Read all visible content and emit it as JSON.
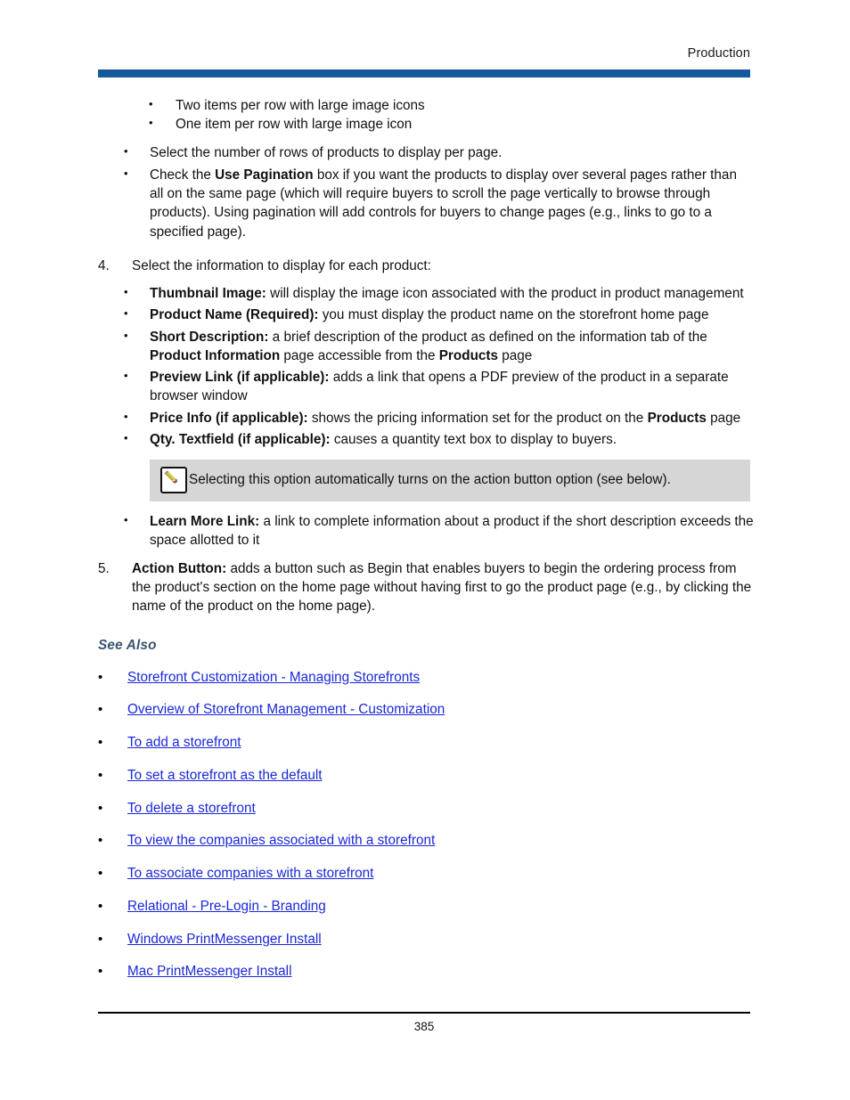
{
  "header": {
    "title": "Production",
    "rule_color": "#14579b"
  },
  "content": {
    "sub_bullets_top": [
      "Two items per row with large image icons",
      "One item per row with large image icon"
    ],
    "level2_bullets": [
      {
        "segments": [
          {
            "text": "Select the number of rows of products to display per page.",
            "bold": false
          }
        ]
      },
      {
        "segments": [
          {
            "text": "Check the ",
            "bold": false
          },
          {
            "text": "Use Pagination",
            "bold": true
          },
          {
            "text": " box if you want the products to display over several pages rather than all on the same page (which will require buyers to scroll the page vertically to browse through products). Using pagination will add controls for buyers to change pages (e.g., links to go to a specified page).",
            "bold": false
          }
        ]
      }
    ],
    "item4": {
      "number": "4.",
      "text": "Select the information to display for each product:"
    },
    "item4_bullets": [
      {
        "segments": [
          {
            "text": "Thumbnail Image:",
            "bold": true
          },
          {
            "text": " will display the image icon associated with the product in product management",
            "bold": false
          }
        ]
      },
      {
        "segments": [
          {
            "text": "Product Name (Required):",
            "bold": true
          },
          {
            "text": " you must display the product name on the storefront home page",
            "bold": false
          }
        ]
      },
      {
        "segments": [
          {
            "text": "Short Description:",
            "bold": true
          },
          {
            "text": " a brief description of the product as defined on the information tab of the ",
            "bold": false
          },
          {
            "text": "Product Information",
            "bold": true
          },
          {
            "text": " page accessible from the ",
            "bold": false
          },
          {
            "text": "Products",
            "bold": true
          },
          {
            "text": " page",
            "bold": false
          }
        ]
      },
      {
        "segments": [
          {
            "text": "Preview Link (if applicable):",
            "bold": true
          },
          {
            "text": " adds a link that opens a PDF preview of the product in a separate browser window",
            "bold": false
          }
        ]
      },
      {
        "segments": [
          {
            "text": "Price Info (if applicable):",
            "bold": true
          },
          {
            "text": " shows the pricing information set for the product on the ",
            "bold": false
          },
          {
            "text": "Products",
            "bold": true
          },
          {
            "text": " page",
            "bold": false
          }
        ]
      },
      {
        "segments": [
          {
            "text": "Qty. Textfield (if applicable):",
            "bold": true
          },
          {
            "text": " causes a quantity text box to display to buyers.",
            "bold": false
          }
        ]
      }
    ],
    "note": {
      "icon": "pencil-note-icon",
      "text": "Selecting this option automatically turns on the action button option (see below).",
      "background": "#d6d6d6"
    },
    "item4_bullets_after_note": [
      {
        "segments": [
          {
            "text": "Learn More Link:",
            "bold": true
          },
          {
            "text": " a link to complete information about a product if the short description exceeds the space allotted to it",
            "bold": false
          }
        ]
      }
    ],
    "item5": {
      "number": "5.",
      "segments": [
        {
          "text": "Action Button:",
          "bold": true
        },
        {
          "text": " adds a button such as Begin that enables buyers to begin the ordering process from the product's section on the home page without having first to go the product page (e.g., by clicking the name of the product on the home page).",
          "bold": false
        }
      ]
    }
  },
  "see_also": {
    "title": "See Also",
    "title_color": "#3a5470",
    "link_color": "#1a28d8",
    "links": [
      "Storefront Customization - Managing Storefronts",
      "Overview of Storefront Management - Customization",
      "To add a storefront",
      "To set a storefront as the default",
      "To delete a storefront",
      "To view the companies associated with a storefront",
      "To associate companies with a storefront",
      "Relational - Pre-Login - Branding",
      "Windows PrintMessenger Install",
      "Mac PrintMessenger Install"
    ]
  },
  "footer": {
    "page_number": "385"
  },
  "bullet_glyph": "•"
}
